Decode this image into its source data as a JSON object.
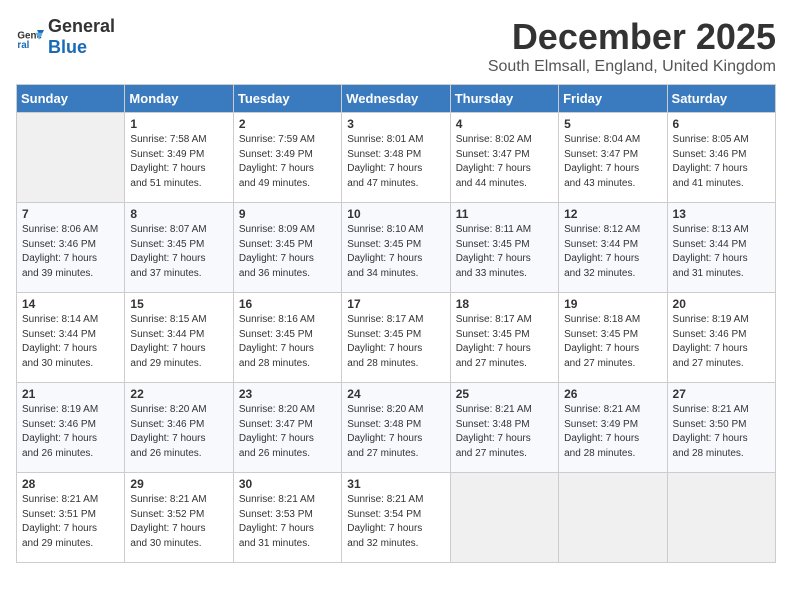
{
  "logo": {
    "general": "General",
    "blue": "Blue"
  },
  "title": "December 2025",
  "subtitle": "South Elmsall, England, United Kingdom",
  "days_of_week": [
    "Sunday",
    "Monday",
    "Tuesday",
    "Wednesday",
    "Thursday",
    "Friday",
    "Saturday"
  ],
  "weeks": [
    [
      {
        "day": "",
        "info": ""
      },
      {
        "day": "1",
        "info": "Sunrise: 7:58 AM\nSunset: 3:49 PM\nDaylight: 7 hours\nand 51 minutes."
      },
      {
        "day": "2",
        "info": "Sunrise: 7:59 AM\nSunset: 3:49 PM\nDaylight: 7 hours\nand 49 minutes."
      },
      {
        "day": "3",
        "info": "Sunrise: 8:01 AM\nSunset: 3:48 PM\nDaylight: 7 hours\nand 47 minutes."
      },
      {
        "day": "4",
        "info": "Sunrise: 8:02 AM\nSunset: 3:47 PM\nDaylight: 7 hours\nand 44 minutes."
      },
      {
        "day": "5",
        "info": "Sunrise: 8:04 AM\nSunset: 3:47 PM\nDaylight: 7 hours\nand 43 minutes."
      },
      {
        "day": "6",
        "info": "Sunrise: 8:05 AM\nSunset: 3:46 PM\nDaylight: 7 hours\nand 41 minutes."
      }
    ],
    [
      {
        "day": "7",
        "info": "Sunrise: 8:06 AM\nSunset: 3:46 PM\nDaylight: 7 hours\nand 39 minutes."
      },
      {
        "day": "8",
        "info": "Sunrise: 8:07 AM\nSunset: 3:45 PM\nDaylight: 7 hours\nand 37 minutes."
      },
      {
        "day": "9",
        "info": "Sunrise: 8:09 AM\nSunset: 3:45 PM\nDaylight: 7 hours\nand 36 minutes."
      },
      {
        "day": "10",
        "info": "Sunrise: 8:10 AM\nSunset: 3:45 PM\nDaylight: 7 hours\nand 34 minutes."
      },
      {
        "day": "11",
        "info": "Sunrise: 8:11 AM\nSunset: 3:45 PM\nDaylight: 7 hours\nand 33 minutes."
      },
      {
        "day": "12",
        "info": "Sunrise: 8:12 AM\nSunset: 3:44 PM\nDaylight: 7 hours\nand 32 minutes."
      },
      {
        "day": "13",
        "info": "Sunrise: 8:13 AM\nSunset: 3:44 PM\nDaylight: 7 hours\nand 31 minutes."
      }
    ],
    [
      {
        "day": "14",
        "info": "Sunrise: 8:14 AM\nSunset: 3:44 PM\nDaylight: 7 hours\nand 30 minutes."
      },
      {
        "day": "15",
        "info": "Sunrise: 8:15 AM\nSunset: 3:44 PM\nDaylight: 7 hours\nand 29 minutes."
      },
      {
        "day": "16",
        "info": "Sunrise: 8:16 AM\nSunset: 3:45 PM\nDaylight: 7 hours\nand 28 minutes."
      },
      {
        "day": "17",
        "info": "Sunrise: 8:17 AM\nSunset: 3:45 PM\nDaylight: 7 hours\nand 28 minutes."
      },
      {
        "day": "18",
        "info": "Sunrise: 8:17 AM\nSunset: 3:45 PM\nDaylight: 7 hours\nand 27 minutes."
      },
      {
        "day": "19",
        "info": "Sunrise: 8:18 AM\nSunset: 3:45 PM\nDaylight: 7 hours\nand 27 minutes."
      },
      {
        "day": "20",
        "info": "Sunrise: 8:19 AM\nSunset: 3:46 PM\nDaylight: 7 hours\nand 27 minutes."
      }
    ],
    [
      {
        "day": "21",
        "info": "Sunrise: 8:19 AM\nSunset: 3:46 PM\nDaylight: 7 hours\nand 26 minutes."
      },
      {
        "day": "22",
        "info": "Sunrise: 8:20 AM\nSunset: 3:46 PM\nDaylight: 7 hours\nand 26 minutes."
      },
      {
        "day": "23",
        "info": "Sunrise: 8:20 AM\nSunset: 3:47 PM\nDaylight: 7 hours\nand 26 minutes."
      },
      {
        "day": "24",
        "info": "Sunrise: 8:20 AM\nSunset: 3:48 PM\nDaylight: 7 hours\nand 27 minutes."
      },
      {
        "day": "25",
        "info": "Sunrise: 8:21 AM\nSunset: 3:48 PM\nDaylight: 7 hours\nand 27 minutes."
      },
      {
        "day": "26",
        "info": "Sunrise: 8:21 AM\nSunset: 3:49 PM\nDaylight: 7 hours\nand 28 minutes."
      },
      {
        "day": "27",
        "info": "Sunrise: 8:21 AM\nSunset: 3:50 PM\nDaylight: 7 hours\nand 28 minutes."
      }
    ],
    [
      {
        "day": "28",
        "info": "Sunrise: 8:21 AM\nSunset: 3:51 PM\nDaylight: 7 hours\nand 29 minutes."
      },
      {
        "day": "29",
        "info": "Sunrise: 8:21 AM\nSunset: 3:52 PM\nDaylight: 7 hours\nand 30 minutes."
      },
      {
        "day": "30",
        "info": "Sunrise: 8:21 AM\nSunset: 3:53 PM\nDaylight: 7 hours\nand 31 minutes."
      },
      {
        "day": "31",
        "info": "Sunrise: 8:21 AM\nSunset: 3:54 PM\nDaylight: 7 hours\nand 32 minutes."
      },
      {
        "day": "",
        "info": ""
      },
      {
        "day": "",
        "info": ""
      },
      {
        "day": "",
        "info": ""
      }
    ]
  ]
}
